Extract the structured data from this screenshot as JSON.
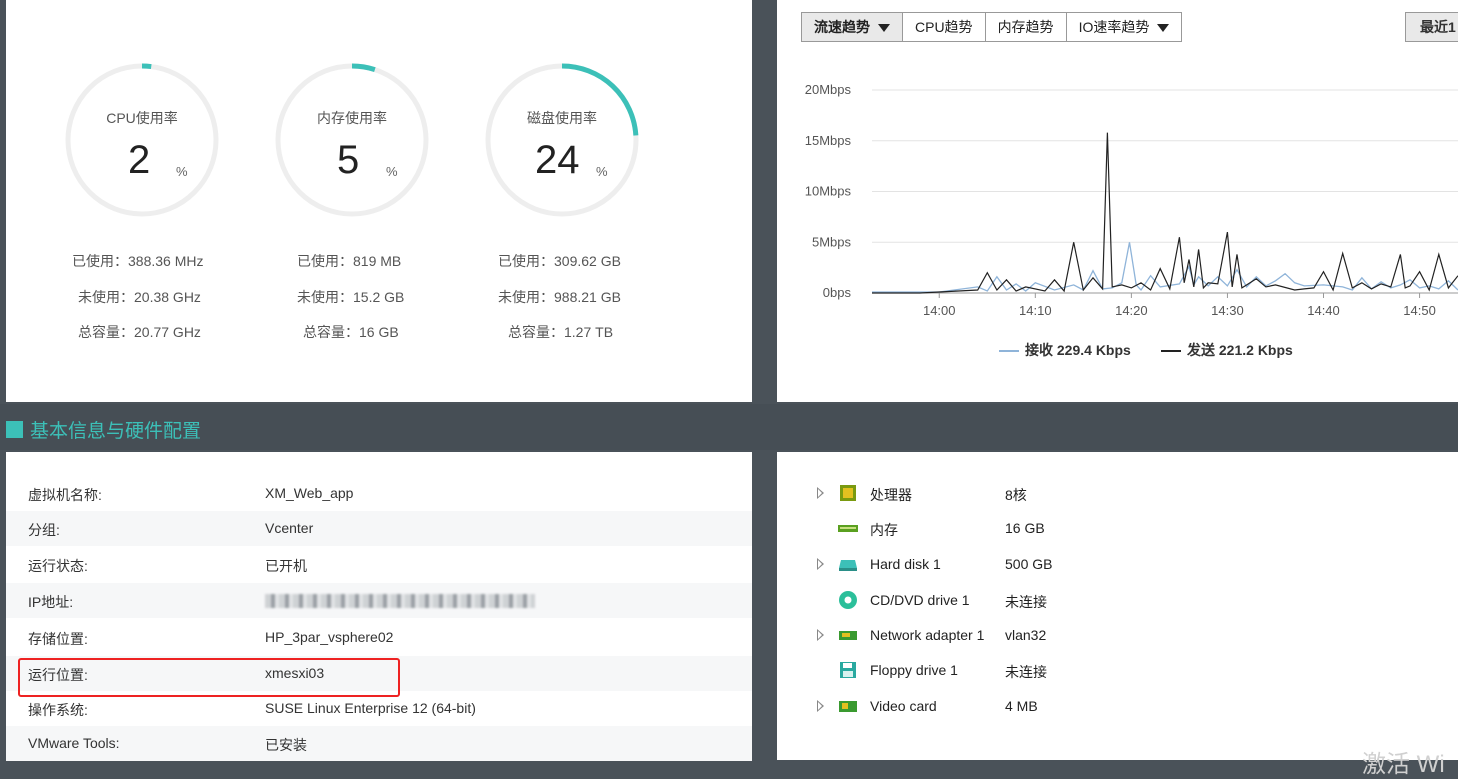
{
  "usage": {
    "gauges": [
      {
        "title": "CPU使用率",
        "value": "2",
        "unit": "%",
        "percent": 2,
        "used": "已使用：388.36 MHz",
        "free": "未使用：20.38 GHz",
        "total": "总容量：20.77 GHz"
      },
      {
        "title": "内存使用率",
        "value": "5",
        "unit": "%",
        "percent": 5,
        "used": "已使用：819 MB",
        "free": "未使用：15.2 GB",
        "total": "总容量：16 GB"
      },
      {
        "title": "磁盘使用率",
        "value": "24",
        "unit": "%",
        "percent": 24,
        "used": "已使用：309.62 GB",
        "free": "未使用：988.21 GB",
        "total": "总容量：1.27 TB"
      }
    ],
    "accent_color": "#3cc0b8"
  },
  "chart_panel": {
    "tabs": [
      {
        "label": "流速趋势",
        "dropdown": true,
        "active": true
      },
      {
        "label": "CPU趋势",
        "dropdown": false,
        "active": false
      },
      {
        "label": "内存趋势",
        "dropdown": false,
        "active": false
      },
      {
        "label": "IO速率趋势",
        "dropdown": true,
        "active": false
      }
    ],
    "recent_button": "最近1"
  },
  "chart_data": {
    "type": "line",
    "title": "",
    "xlabel": "",
    "ylabel": "",
    "y_ticks": [
      "20Mbps",
      "15Mbps",
      "10Mbps",
      "5Mbps",
      "0bps"
    ],
    "x_ticks": [
      "14:00",
      "14:10",
      "14:20",
      "14:30",
      "14:40",
      "14:50"
    ],
    "ylim": [
      0,
      20
    ],
    "xlim_minutes": [
      53,
      114
    ],
    "grid": true,
    "series": [
      {
        "name": "接收 229.4 Kbps",
        "color": "#8fb4d9",
        "points": [
          [
            53,
            0.1
          ],
          [
            60,
            0.1
          ],
          [
            64,
            0.6
          ],
          [
            65,
            0.2
          ],
          [
            66,
            1.6
          ],
          [
            67,
            0.3
          ],
          [
            68,
            0.9
          ],
          [
            69,
            0.2
          ],
          [
            70,
            1.0
          ],
          [
            72,
            0.3
          ],
          [
            74,
            0.8
          ],
          [
            75,
            0.3
          ],
          [
            76,
            2.2
          ],
          [
            77,
            0.4
          ],
          [
            78,
            0.5
          ],
          [
            79,
            1.0
          ],
          [
            79.8,
            5.0
          ],
          [
            80.5,
            0.8
          ],
          [
            81,
            0.3
          ],
          [
            82,
            1.7
          ],
          [
            83,
            0.6
          ],
          [
            85,
            0.9
          ],
          [
            86,
            2.6
          ],
          [
            86.5,
            0.8
          ],
          [
            87,
            1.6
          ],
          [
            88,
            0.7
          ],
          [
            89,
            1.6
          ],
          [
            90,
            0.7
          ],
          [
            91,
            2.3
          ],
          [
            92,
            0.6
          ],
          [
            93,
            1.6
          ],
          [
            94,
            0.7
          ],
          [
            95,
            1.2
          ],
          [
            96,
            1.9
          ],
          [
            97,
            1.0
          ],
          [
            98,
            0.7
          ],
          [
            100,
            0.8
          ],
          [
            102,
            0.6
          ],
          [
            103,
            0.3
          ],
          [
            104,
            1.5
          ],
          [
            105,
            0.4
          ],
          [
            106,
            1.1
          ],
          [
            107,
            0.5
          ],
          [
            108,
            0.8
          ],
          [
            109,
            1.3
          ],
          [
            110,
            0.5
          ],
          [
            111,
            0.7
          ],
          [
            112,
            0.4
          ],
          [
            113,
            1.2
          ],
          [
            114,
            0.3
          ]
        ]
      },
      {
        "name": "发送 221.2 Kbps",
        "color": "#222222",
        "points": [
          [
            53,
            0.0
          ],
          [
            58,
            0.0
          ],
          [
            62,
            0.2
          ],
          [
            64,
            0.3
          ],
          [
            65,
            2.0
          ],
          [
            66,
            0.3
          ],
          [
            67,
            1.3
          ],
          [
            68,
            0.2
          ],
          [
            69,
            0.6
          ],
          [
            71,
            0.2
          ],
          [
            72,
            1.3
          ],
          [
            73,
            0.2
          ],
          [
            74,
            5.0
          ],
          [
            75,
            0.3
          ],
          [
            76,
            1.5
          ],
          [
            77,
            0.4
          ],
          [
            77.5,
            15.8
          ],
          [
            78,
            0.6
          ],
          [
            79,
            0.8
          ],
          [
            80,
            0.5
          ],
          [
            81,
            1.0
          ],
          [
            82,
            0.3
          ],
          [
            83,
            2.4
          ],
          [
            84,
            0.4
          ],
          [
            85,
            5.5
          ],
          [
            85.5,
            1.0
          ],
          [
            86,
            3.3
          ],
          [
            86.5,
            0.6
          ],
          [
            87,
            4.3
          ],
          [
            87.5,
            0.5
          ],
          [
            88,
            1.0
          ],
          [
            89,
            0.9
          ],
          [
            90,
            6.0
          ],
          [
            90.5,
            0.6
          ],
          [
            91,
            3.8
          ],
          [
            91.5,
            0.5
          ],
          [
            92,
            0.8
          ],
          [
            93,
            1.4
          ],
          [
            94,
            0.6
          ],
          [
            95,
            0.8
          ],
          [
            97,
            0.3
          ],
          [
            98,
            0.4
          ],
          [
            99,
            0.5
          ],
          [
            100,
            2.1
          ],
          [
            101,
            0.3
          ],
          [
            102,
            3.9
          ],
          [
            103,
            0.5
          ],
          [
            104,
            1.0
          ],
          [
            105,
            0.4
          ],
          [
            106,
            0.9
          ],
          [
            107,
            0.6
          ],
          [
            108,
            3.8
          ],
          [
            108.5,
            0.5
          ],
          [
            109,
            0.7
          ],
          [
            110,
            2.1
          ],
          [
            111,
            0.3
          ],
          [
            112,
            3.8
          ],
          [
            113,
            0.5
          ],
          [
            114,
            1.7
          ]
        ]
      }
    ],
    "legend": [
      {
        "label": "接收 229.4 Kbps",
        "color": "#8fb4d9"
      },
      {
        "label": "发送 221.2 Kbps",
        "color": "#222222"
      }
    ]
  },
  "section": {
    "title": "基本信息与硬件配置"
  },
  "info": {
    "rows": [
      {
        "label": "虚拟机名称:",
        "value": "XM_Web_app"
      },
      {
        "label": "分组:",
        "value": "Vcenter"
      },
      {
        "label": "运行状态:",
        "value": "已开机"
      },
      {
        "label": "IP地址:",
        "value": ""
      },
      {
        "label": "存储位置:",
        "value": "HP_3par_vsphere02"
      },
      {
        "label": "运行位置:",
        "value": "xmesxi03"
      },
      {
        "label": "操作系统:",
        "value": "SUSE Linux Enterprise 12 (64-bit)"
      },
      {
        "label": "VMware Tools:",
        "value": "已安装"
      }
    ]
  },
  "hardware": {
    "rows": [
      {
        "label": "处理器",
        "value": "8核",
        "expandable": true,
        "icon": "processor-icon"
      },
      {
        "label": "内存",
        "value": "16 GB",
        "expandable": false,
        "icon": "memory-icon"
      },
      {
        "label": "Hard disk 1",
        "value": "500 GB",
        "expandable": true,
        "icon": "hard-disk-icon"
      },
      {
        "label": "CD/DVD drive 1",
        "value": "未连接",
        "expandable": false,
        "icon": "cd-dvd-icon"
      },
      {
        "label": "Network adapter 1",
        "value": "vlan32",
        "expandable": true,
        "icon": "network-adapter-icon"
      },
      {
        "label": "Floppy drive 1",
        "value": "未连接",
        "expandable": false,
        "icon": "floppy-icon"
      },
      {
        "label": "Video card",
        "value": "4 MB",
        "expandable": true,
        "icon": "video-card-icon"
      }
    ],
    "watermark": "激活 Wi"
  }
}
